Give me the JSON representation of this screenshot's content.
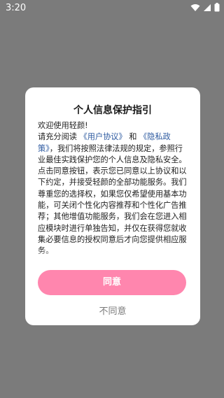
{
  "status_bar": {
    "time": "3:20",
    "wifi_icon": "wifi-icon",
    "signal_icon": "cellular-signal-icon",
    "battery_icon": "battery-icon"
  },
  "dialog": {
    "title": "个人信息保护指引",
    "welcome": "欢迎使用轻颜!",
    "intro_prefix": "请充分阅读 ",
    "user_agreement_link": "《用户协议》",
    "and": " 和 ",
    "privacy_policy_link": "《隐私政策》",
    "body_text": "，我们将按照法律法规的规定，参照行业最佳实践保护您的个人信息及隐私安全。点击同意按钮，表示您已同意以上协议和以下约定，并接受轻颜的全部功能服务。我们尊重您的选择权，如果您仅希望使用基本功能，可关闭个性化内容推荐和个性化广告推荐；其他增值功能服务，我们会在您进入相应模块时进行单独告知，并仅在获得您就收集必要信息的授权同意后才向您提供相应服务。",
    "agree_label": "同意",
    "disagree_label": "不同意"
  },
  "colors": {
    "overlay": "#7b7b7b",
    "accent": "#ff86ae",
    "link": "#2d5aa0"
  }
}
